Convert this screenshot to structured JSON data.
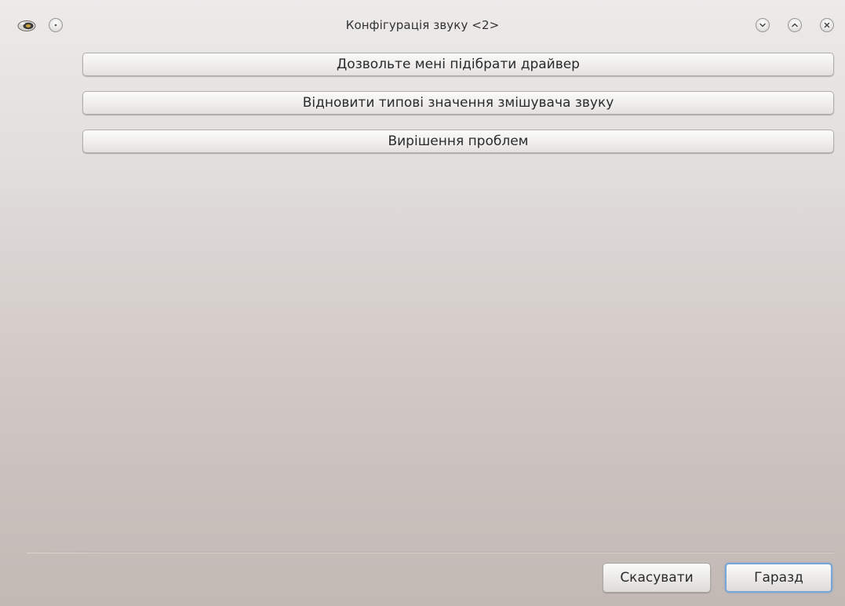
{
  "window": {
    "title": "Конфігурація звуку <2>"
  },
  "titlebar_icons": {
    "app_icon": "speaker-icon",
    "menu_button": "window-menu-icon",
    "minimize": "chevron-down-icon",
    "maximize": "chevron-up-icon",
    "close": "close-icon"
  },
  "actions": [
    {
      "label": "Дозвольте мені підібрати драйвер"
    },
    {
      "label": "Відновити типові значення змішувача звуку"
    },
    {
      "label": "Вирішення проблем"
    }
  ],
  "footer": {
    "cancel_label": "Скасувати",
    "ok_label": "Гаразд"
  },
  "colors": {
    "focus_accent": "#78a6d8"
  }
}
